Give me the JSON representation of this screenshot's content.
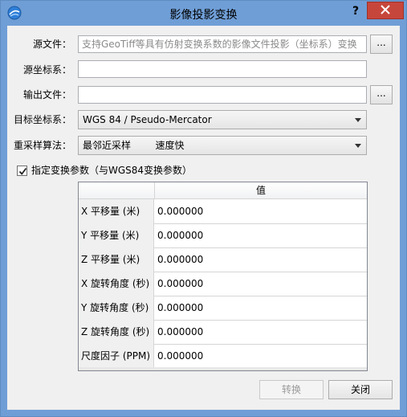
{
  "window": {
    "title": "影像投影变换",
    "help_label": "?"
  },
  "form": {
    "source_file": {
      "label": "源文件：",
      "placeholder": "支持GeoTiff等具有仿射变换系数的影像文件投影（坐标系）变换",
      "browse_label": "..."
    },
    "source_crs": {
      "label": "源坐标系：",
      "value": ""
    },
    "output_file": {
      "label": "输出文件：",
      "value": "",
      "browse_label": "..."
    },
    "target_crs": {
      "label": "目标坐标系：",
      "selected": "WGS 84 / Pseudo-Mercator"
    },
    "resampling": {
      "label": "重采样算法：",
      "selected": "最邻近采样        速度快"
    },
    "custom_params": {
      "checked": true,
      "label": "指定变换参数（与WGS84变换参数）"
    }
  },
  "params_table": {
    "column_header": "值",
    "rows": [
      {
        "name": "X 平移量 (米)",
        "value": "0.000000"
      },
      {
        "name": "Y 平移量 (米)",
        "value": "0.000000"
      },
      {
        "name": "Z 平移量 (米)",
        "value": "0.000000"
      },
      {
        "name": "X 旋转角度 (秒)",
        "value": "0.000000"
      },
      {
        "name": "Y 旋转角度 (秒)",
        "value": "0.000000"
      },
      {
        "name": "Z 旋转角度 (秒)",
        "value": "0.000000"
      },
      {
        "name": "尺度因子 (PPM)",
        "value": "0.000000"
      }
    ]
  },
  "buttons": {
    "convert_label": "转换",
    "close_label": "关闭"
  },
  "colors": {
    "titlebar": "#6f9ed6",
    "close_button": "#c7463b",
    "dialog_background": "#f0f0f0"
  }
}
